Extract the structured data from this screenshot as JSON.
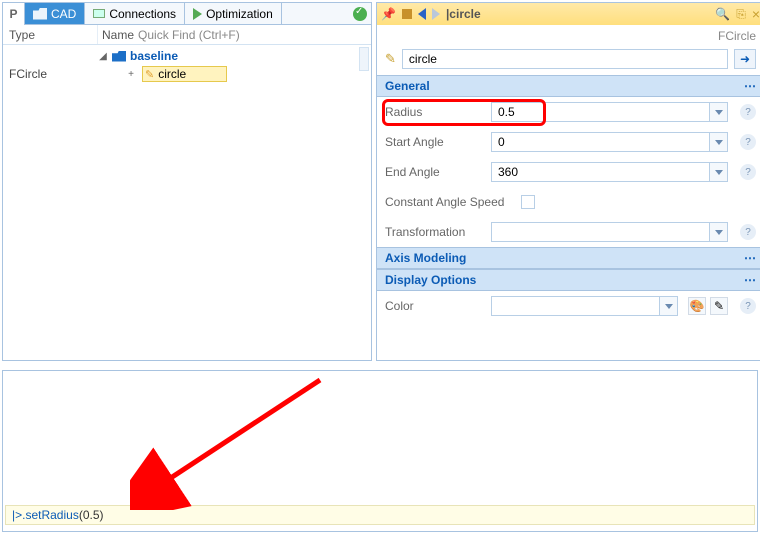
{
  "tabs": {
    "p_letter": "P",
    "cad": "CAD",
    "connections": "Connections",
    "optimization": "Optimization"
  },
  "list_headers": {
    "type": "Type",
    "name": "Name",
    "quickfind": "Quick Find (Ctrl+F)"
  },
  "tree": {
    "root_label": "baseline",
    "leaf_type": "FCircle",
    "leaf_name": "circle"
  },
  "titlebar": {
    "title": "|circle"
  },
  "breadcrumb": "FCircle",
  "name_input": "circle",
  "sections": {
    "general": "General",
    "axis": "Axis Modeling",
    "display": "Display Options"
  },
  "props": {
    "radius": {
      "label": "Radius",
      "value": "0.5"
    },
    "start_angle": {
      "label": "Start Angle",
      "value": "0"
    },
    "end_angle": {
      "label": "End Angle",
      "value": "360"
    },
    "const_speed": {
      "label": "Constant Angle Speed"
    },
    "transformation": {
      "label": "Transformation",
      "value": ""
    },
    "color": {
      "label": "Color",
      "value": ""
    }
  },
  "console": {
    "prompt": "|> ",
    "method": ".setRadius",
    "args": "(0.5)"
  }
}
